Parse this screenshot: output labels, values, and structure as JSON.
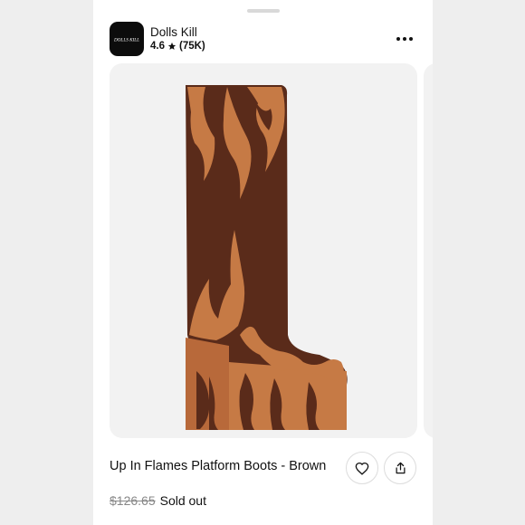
{
  "store": {
    "name": "Dolls Kill",
    "logo_text": "DOLLS KILL",
    "rating": "4.6",
    "review_count": "(75K)"
  },
  "product": {
    "title": "Up In Flames Platform Boots - Brown",
    "original_price": "$126.65",
    "status": "Sold out"
  },
  "icons": {
    "rating": "star-icon",
    "more": "more-dots-icon",
    "favorite": "heart-icon",
    "share": "share-icon"
  },
  "colors": {
    "suede_dark": "#5a2b1a",
    "suede_tan": "#c67a45",
    "background": "#eeeeee"
  }
}
